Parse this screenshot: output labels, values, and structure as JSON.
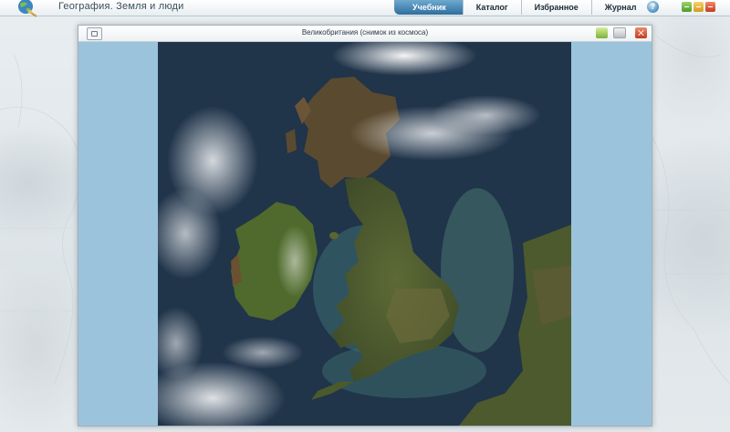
{
  "app": {
    "title": "География. Земля и люди"
  },
  "tabs": [
    {
      "label": "Учебник",
      "active": true
    },
    {
      "label": "Каталог",
      "active": false
    },
    {
      "label": "Избранное",
      "active": false
    },
    {
      "label": "Журнал",
      "active": false
    }
  ],
  "help": {
    "glyph": "?"
  },
  "viewer": {
    "title": "Великобритания (снимок из космоса)"
  },
  "colors": {
    "accent": "#2e6f9d",
    "viewer_background": "#9bc4dc",
    "sea": "#1c2f45",
    "land": "#4c5a2e"
  }
}
